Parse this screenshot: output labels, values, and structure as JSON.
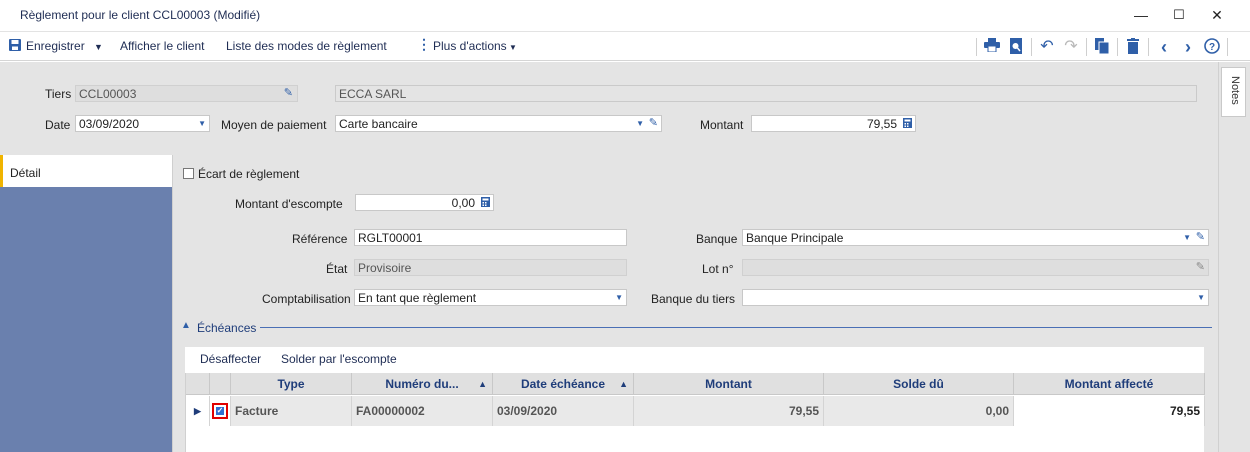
{
  "window": {
    "title": "Règlement pour le client CCL00003 (Modifié)",
    "minimize": "—",
    "maximize": "☐",
    "close": "✕"
  },
  "toolbar": {
    "save_label": "Enregistrer",
    "show_client_label": "Afficher le client",
    "payment_modes_label": "Liste des modes de règlement",
    "more_actions_label": "Plus d'actions"
  },
  "header": {
    "tiers_label": "Tiers",
    "tiers_code": "CCL00003",
    "tiers_name": "ECCA SARL",
    "date_label": "Date",
    "date_value": "03/09/2020",
    "payment_method_label": "Moyen de paiement",
    "payment_method_value": "Carte bancaire",
    "amount_label": "Montant",
    "amount_value": "79,55"
  },
  "notes_tab": "Notes",
  "sidebar": {
    "items": [
      {
        "label": "Détail"
      }
    ]
  },
  "detail": {
    "ecart_label": "Écart de règlement",
    "escompte_label": "Montant d'escompte",
    "escompte_value": "0,00",
    "reference_label": "Référence",
    "reference_value": "RGLT00001",
    "etat_label": "État",
    "etat_value": "Provisoire",
    "comptabilisation_label": "Comptabilisation",
    "comptabilisation_value": "En tant que règlement",
    "banque_label": "Banque",
    "banque_value": "Banque Principale",
    "lot_label": "Lot n°",
    "lot_value": "",
    "banque_tiers_label": "Banque du tiers",
    "banque_tiers_value": ""
  },
  "echeances": {
    "section_label": "Échéances",
    "desaffecter_label": "Désaffecter",
    "solder_label": "Solder par l'escompte",
    "columns": [
      "Type",
      "Numéro du...",
      "Date échéance",
      "Montant",
      "Solde dû",
      "Montant affecté"
    ],
    "rows": [
      {
        "type": "Facture",
        "numero": "FA00000002",
        "date": "03/09/2020",
        "montant": "79,55",
        "solde": "0,00",
        "affecte": "79,55",
        "checked": true
      }
    ]
  }
}
